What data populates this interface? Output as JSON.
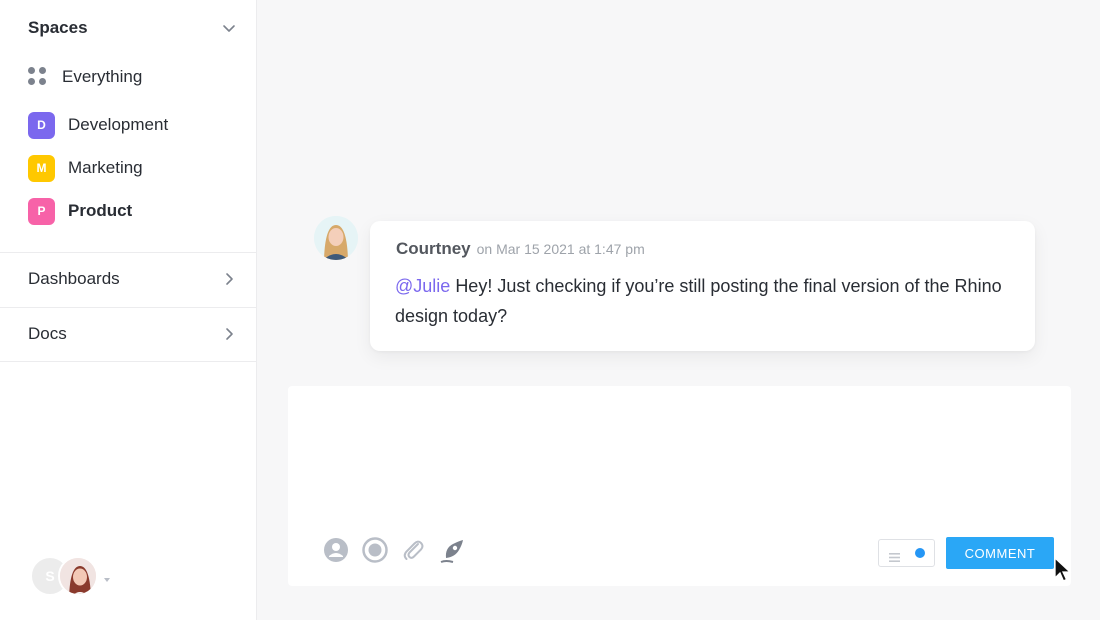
{
  "sidebar": {
    "spaces_title": "Spaces",
    "everything_label": "Everything",
    "spaces": [
      {
        "label": "Development",
        "badge": "D",
        "color": "#7b68ee"
      },
      {
        "label": "Marketing",
        "badge": "M",
        "color": "#ffc800"
      },
      {
        "label": "Product",
        "badge": "P",
        "color": "#f762a8"
      }
    ],
    "dashboards_label": "Dashboards",
    "docs_label": "Docs",
    "avatar_initial": "S"
  },
  "comment": {
    "author": "Courtney",
    "timestamp": "on Mar 15 2021 at 1:47 pm",
    "mention": "@Julie",
    "text": "Hey! Just checking if you’re still posting the final version of the Rhino design today?"
  },
  "composer": {
    "value": "",
    "placeholder": "",
    "submit_label": "COMMENT",
    "icons": [
      "mention-icon",
      "record-icon",
      "attachment-icon",
      "slash-command-icon"
    ]
  },
  "colors": {
    "accent": "#7b68ee",
    "button": "#2aa7f6"
  }
}
